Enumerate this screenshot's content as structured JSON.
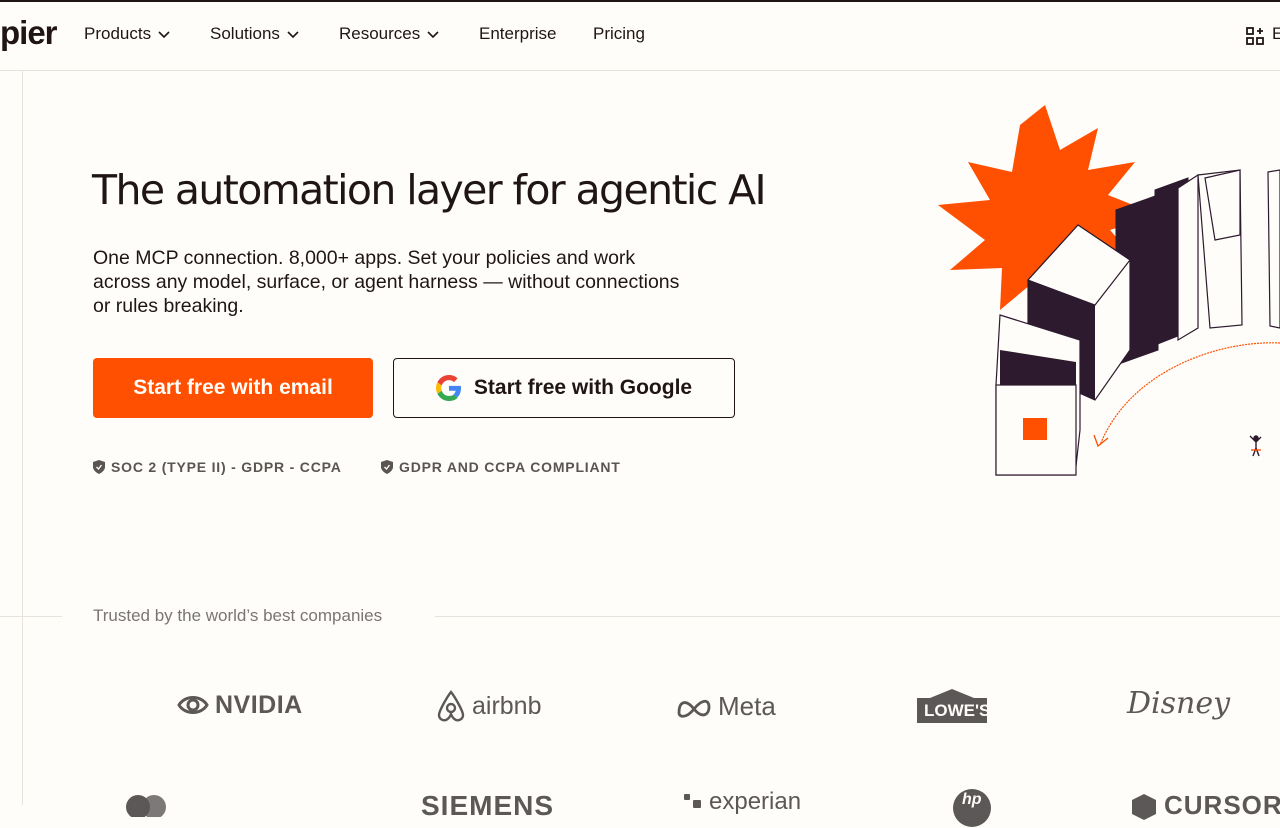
{
  "nav": {
    "logo": "pier",
    "items": [
      {
        "label": "Products",
        "has_dropdown": true
      },
      {
        "label": "Solutions",
        "has_dropdown": true
      },
      {
        "label": "Resources",
        "has_dropdown": true
      },
      {
        "label": "Enterprise",
        "has_dropdown": false
      },
      {
        "label": "Pricing",
        "has_dropdown": false
      }
    ],
    "right_label": "E",
    "right_icon": "apps-grid-icon"
  },
  "hero": {
    "headline": "The automation layer for agentic AI",
    "subtext": "One MCP connection. 8,000+ apps. Set your policies and work across any model, surface, or agent harness — without connections or rules breaking.",
    "cta_email": "Start free with email",
    "cta_google": "Start free with Google",
    "badges": [
      "SOC 2 (TYPE II) - GDPR - CCPA",
      "GDPR AND CCPA COMPLIANT"
    ]
  },
  "trusted": {
    "label": "Trusted by the world’s best companies",
    "logos": [
      "NVIDIA",
      "airbnb",
      "Meta",
      "LOWE'S",
      "Disney",
      "SIEMENS",
      "experian",
      "hp",
      "CURSOR"
    ]
  },
  "colors": {
    "accent": "#ff4f00",
    "text": "#201515",
    "background": "#fffdf9",
    "dark_purple": "#2d1a2e"
  }
}
